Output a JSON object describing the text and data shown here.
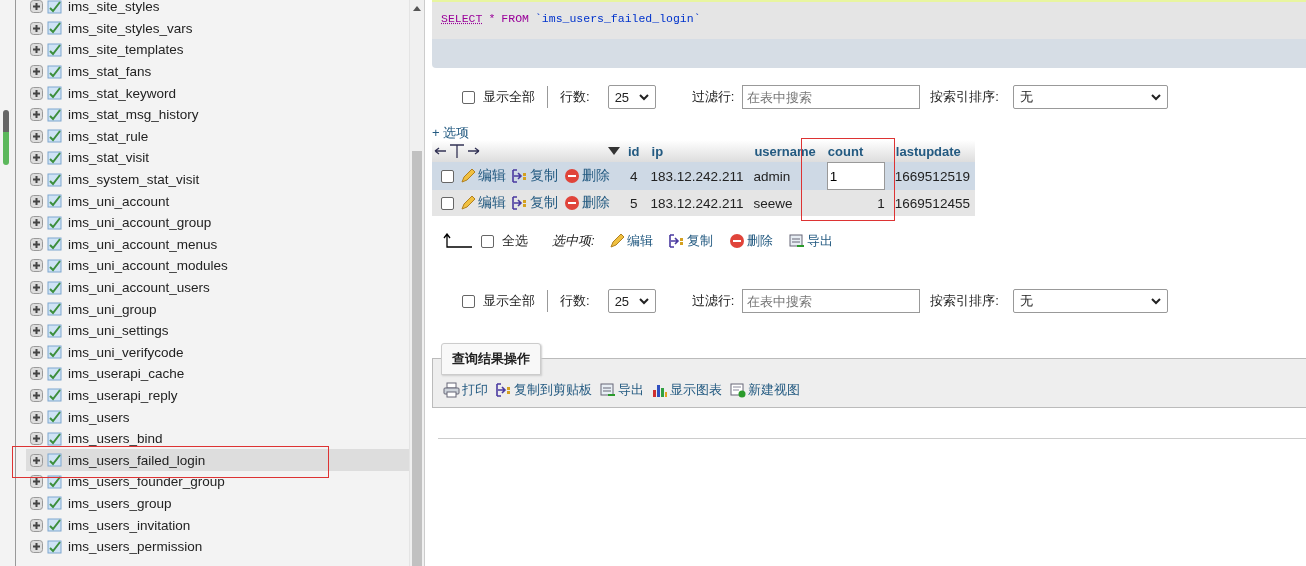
{
  "sidebar": {
    "tables": [
      {
        "name": "ims_site_styles",
        "selected": false
      },
      {
        "name": "ims_site_styles_vars",
        "selected": false
      },
      {
        "name": "ims_site_templates",
        "selected": false
      },
      {
        "name": "ims_stat_fans",
        "selected": false
      },
      {
        "name": "ims_stat_keyword",
        "selected": false
      },
      {
        "name": "ims_stat_msg_history",
        "selected": false
      },
      {
        "name": "ims_stat_rule",
        "selected": false
      },
      {
        "name": "ims_stat_visit",
        "selected": false
      },
      {
        "name": "ims_system_stat_visit",
        "selected": false
      },
      {
        "name": "ims_uni_account",
        "selected": false
      },
      {
        "name": "ims_uni_account_group",
        "selected": false
      },
      {
        "name": "ims_uni_account_menus",
        "selected": false
      },
      {
        "name": "ims_uni_account_modules",
        "selected": false
      },
      {
        "name": "ims_uni_account_users",
        "selected": false
      },
      {
        "name": "ims_uni_group",
        "selected": false
      },
      {
        "name": "ims_uni_settings",
        "selected": false
      },
      {
        "name": "ims_uni_verifycode",
        "selected": false
      },
      {
        "name": "ims_userapi_cache",
        "selected": false
      },
      {
        "name": "ims_userapi_reply",
        "selected": false
      },
      {
        "name": "ims_users",
        "selected": false
      },
      {
        "name": "ims_users_bind",
        "selected": false
      },
      {
        "name": "ims_users_failed_login",
        "selected": true
      },
      {
        "name": "ims_users_founder_group",
        "selected": false
      },
      {
        "name": "ims_users_group",
        "selected": false
      },
      {
        "name": "ims_users_invitation",
        "selected": false
      },
      {
        "name": "ims_users_permission",
        "selected": false
      }
    ]
  },
  "query": {
    "tokens": [
      {
        "text": "SELECT",
        "kind": "keyword"
      },
      {
        "text": "*",
        "kind": "operator"
      },
      {
        "text": "FROM",
        "kind": "keyword"
      },
      {
        "text": "`ims_users_failed_login`",
        "kind": "identifier"
      }
    ]
  },
  "navigation": [
    {
      "show_all": "显示全部",
      "show_all_checked": false,
      "rows_label": "行数:",
      "rows_value": "25",
      "filter_label": "过滤行:",
      "filter_placeholder": "在表中搜索",
      "sort_label": "按索引排序:",
      "sort_value": "无"
    },
    {
      "show_all": "显示全部",
      "show_all_checked": false,
      "rows_label": "行数:",
      "rows_value": "25",
      "filter_label": "过滤行:",
      "filter_placeholder": "在表中搜索",
      "sort_label": "按索引排序:",
      "sort_value": "无"
    }
  ],
  "options_link": "+ 选项",
  "table": {
    "columns": [
      "id",
      "ip",
      "username",
      "count",
      "lastupdate"
    ],
    "rows": [
      {
        "checked": false,
        "highlighted": true,
        "actions": [
          {
            "label": "编辑",
            "kind": "edit"
          },
          {
            "label": "复制",
            "kind": "copy"
          },
          {
            "label": "删除",
            "kind": "delete"
          }
        ],
        "cells": [
          {
            "text": "4",
            "editing": false
          },
          {
            "text": "183.12.242.211",
            "editing": false
          },
          {
            "text": "admin",
            "editing": false
          },
          {
            "text": "1",
            "editing": true
          },
          {
            "text": "1669512519",
            "editing": false
          }
        ]
      },
      {
        "checked": false,
        "highlighted": false,
        "actions": [
          {
            "label": "编辑",
            "kind": "edit"
          },
          {
            "label": "复制",
            "kind": "copy"
          },
          {
            "label": "删除",
            "kind": "delete"
          }
        ],
        "cells": [
          {
            "text": "5",
            "editing": false
          },
          {
            "text": "183.12.242.211",
            "editing": false
          },
          {
            "text": "seewe",
            "editing": false
          },
          {
            "text": "1",
            "editing": false
          },
          {
            "text": "1669512455",
            "editing": false
          }
        ]
      }
    ]
  },
  "bulk": {
    "select_all": "全选",
    "checked": false,
    "with_selected": "选中项:",
    "actions": [
      {
        "label": "编辑",
        "kind": "edit"
      },
      {
        "label": "复制",
        "kind": "copy"
      },
      {
        "label": "删除",
        "kind": "delete"
      },
      {
        "label": "导出",
        "kind": "export"
      }
    ]
  },
  "query_results": {
    "legend": "查询结果操作",
    "actions": [
      {
        "label": "打印",
        "kind": "print"
      },
      {
        "label": "复制到剪贴板",
        "kind": "copy"
      },
      {
        "label": "导出",
        "kind": "export"
      },
      {
        "label": "显示图表",
        "kind": "chart"
      },
      {
        "label": "新建视图",
        "kind": "view"
      }
    ]
  }
}
